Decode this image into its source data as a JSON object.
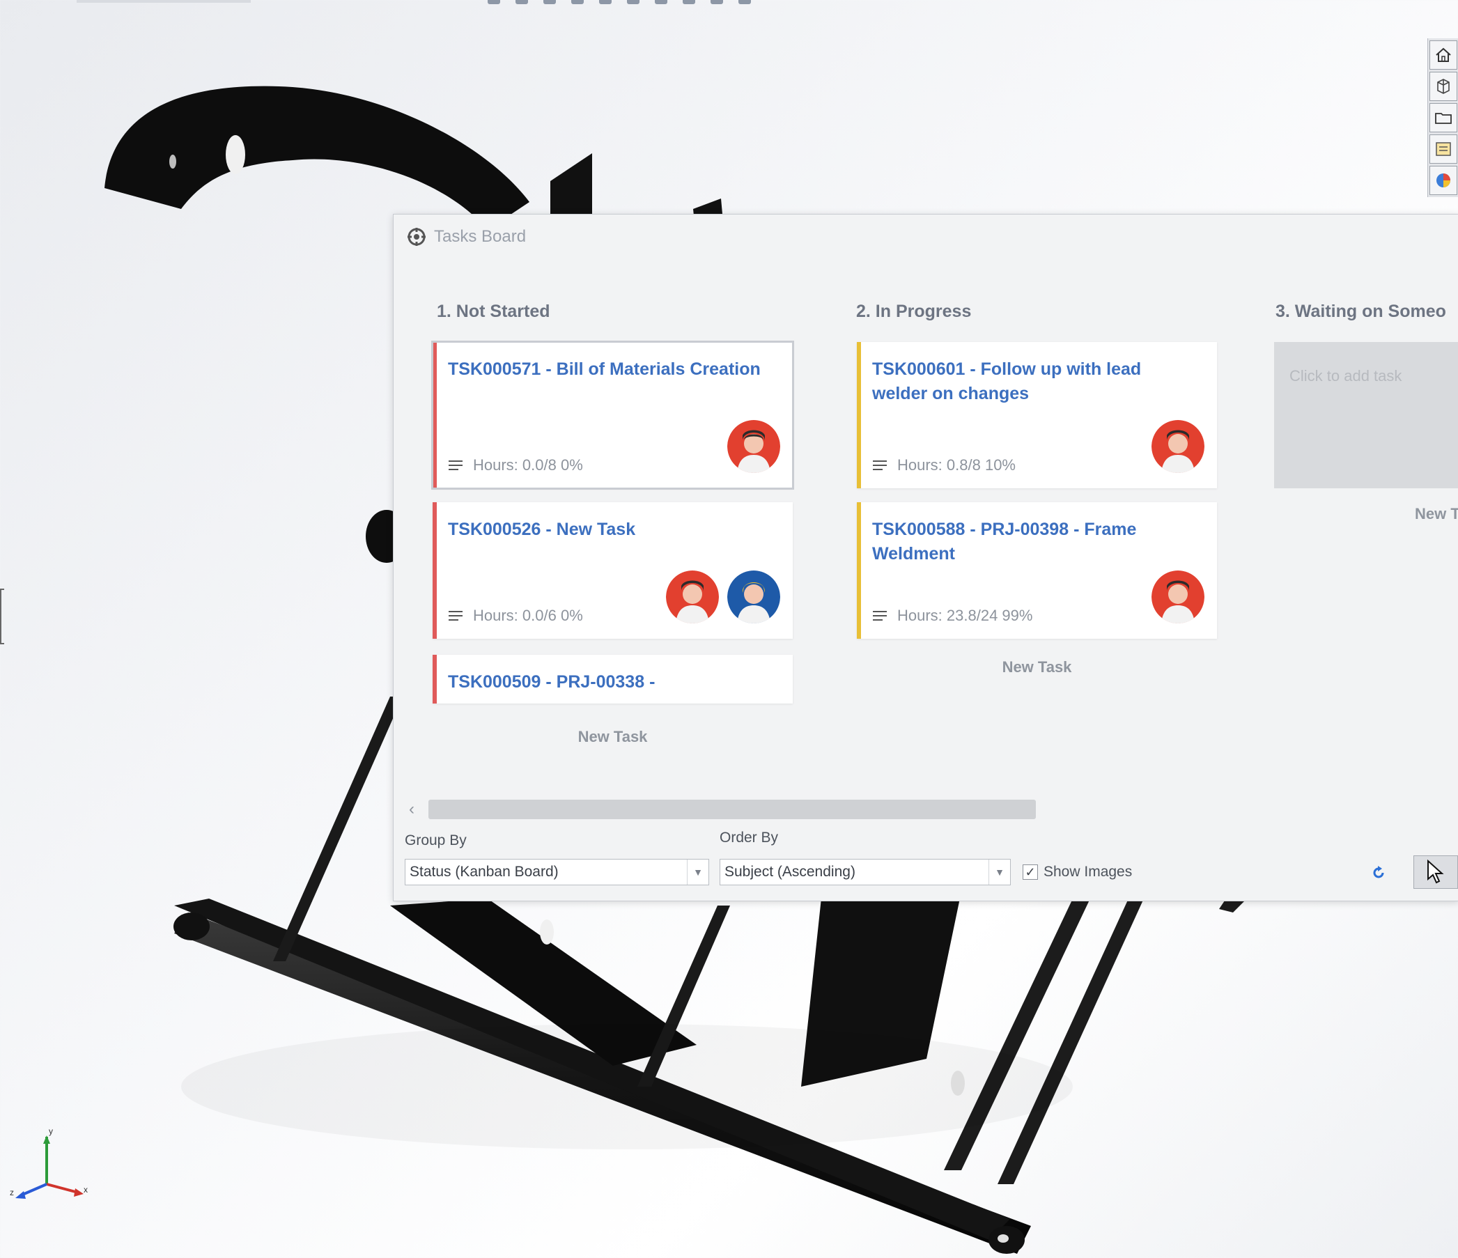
{
  "dialog": {
    "title": "Tasks Board"
  },
  "columns": [
    {
      "header": "1. Not Started",
      "new_task_label": "New Task",
      "cards": [
        {
          "title": "TSK000571 - Bill of Materials Creation",
          "hours": "Hours: 0.0/8 0%"
        },
        {
          "title": "TSK000526 - New Task",
          "hours": "Hours: 0.0/6 0%"
        },
        {
          "title": "TSK000509 - PRJ-00338 -"
        }
      ]
    },
    {
      "header": "2. In Progress",
      "new_task_label": "New Task",
      "cards": [
        {
          "title": "TSK000601 - Follow up with lead welder on changes",
          "hours": "Hours: 0.8/8 10%"
        },
        {
          "title": "TSK000588 - PRJ-00398 - Frame Weldment",
          "hours": "Hours: 23.8/24 99%"
        }
      ]
    },
    {
      "header": "3. Waiting on Someo",
      "placeholder": "Click to add task",
      "new_task_label": "New T"
    }
  ],
  "footer": {
    "group_by_label": "Group By",
    "group_by_value": "Status (Kanban Board)",
    "order_by_label": "Order By",
    "order_by_value": "Subject (Ascending)",
    "show_images_label": "Show Images",
    "show_images_checked": "✓"
  },
  "icons": [
    "dialog-app-icon",
    "notes-icon",
    "avatar-icon",
    "chevron-down-icon",
    "refresh-icon",
    "pointer-icon",
    "home-icon",
    "cube-icon",
    "folder-icon",
    "properties-icon",
    "appearance-icon"
  ],
  "colors": {
    "accent_red": "#e05a5a",
    "accent_yellow": "#e8bf36",
    "title_blue": "#3c6fbf"
  },
  "triad": {
    "x": "x",
    "y": "y",
    "z": "z"
  }
}
